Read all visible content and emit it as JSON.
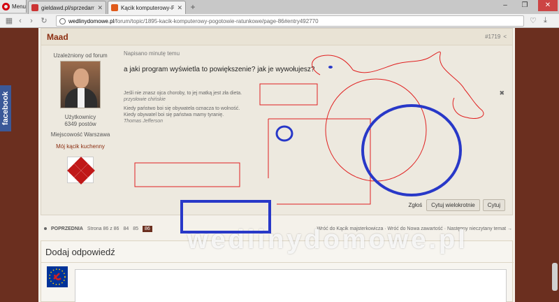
{
  "browser": {
    "menu_label": "Menu",
    "tabs": [
      {
        "title": "gieldawd.pl/sprzedam",
        "favicon_color": "#c33"
      },
      {
        "title": "Kącik komputerowy-Pogot",
        "favicon_color": "#e05a1a"
      }
    ],
    "url_host": "wedlinydomowe.pl",
    "url_path": "/forum/topic/1895-kacik-komputerowy-pogotowie-ratunkowe/page-86#entry492770",
    "window_controls": [
      "–",
      "❐",
      "✕"
    ]
  },
  "facebook_tab": "facebook",
  "post": {
    "author": "Maad",
    "post_number": "#1719",
    "user": {
      "rank": "Uzależniony od forum",
      "role": "Użytkownicy",
      "post_count": "6349 postów",
      "location_label": "Miejscowość",
      "location": "Warszawa",
      "link": "Mój kącik kuchenny"
    },
    "meta": "Napisano minutę temu",
    "text": "a jaki program wyświetla to powiększenie? jak je wywołujesz?",
    "signature": {
      "quote1": "Jeśli nie znasz ojca choroby, to jej matką jest zła dieta.",
      "cite1": "przysłowie chińskie",
      "quote2": "Kiedy państwo boi się obywatela oznacza to wolność.",
      "quote3": "Kiedy obywatel boi się państwa mamy tyranię.",
      "cite2": "Thomas Jefferson"
    },
    "actions": {
      "report": "Zgłoś",
      "multiquote": "Cytuj wielokrotnie",
      "quote": "Cytuj"
    }
  },
  "pagination": {
    "prev": "POPRZEDNIA",
    "page_info": "Strona 86 z 86",
    "pages": [
      "84",
      "85",
      "86"
    ],
    "current": "86",
    "links": "Wróć do Kącik majsterkowicza · Wróć do Nowa zawartość · Następny nieczytany temat →"
  },
  "reply": {
    "title": "Dodaj odpowiedź"
  },
  "watermark": "wedlinydomowe.pl",
  "colors": {
    "brand_brown": "#6b2f1f",
    "author_red": "#8b2d10",
    "annotation_red": "#e02020",
    "annotation_blue": "#2838c8"
  }
}
